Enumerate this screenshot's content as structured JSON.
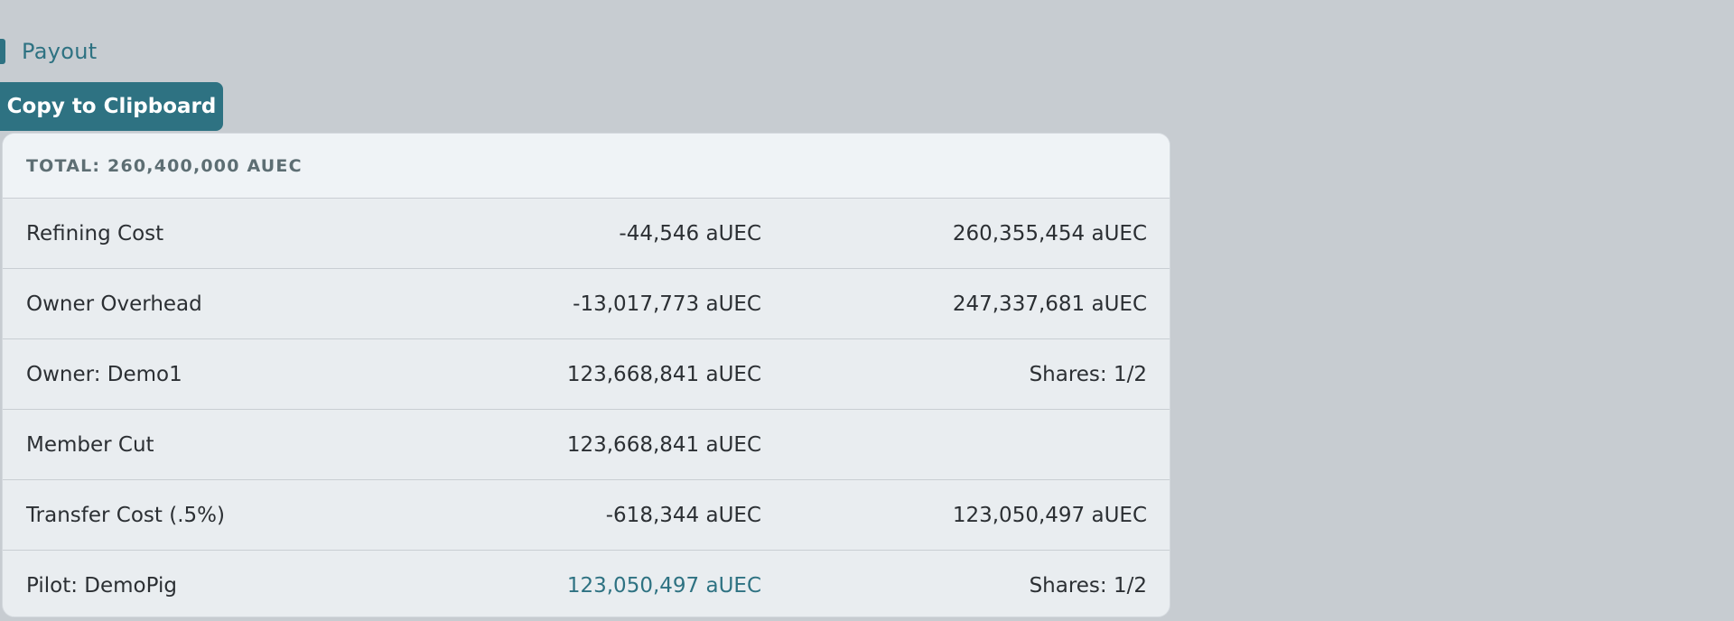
{
  "section": {
    "title": "Payout"
  },
  "toolbar": {
    "copy_label": "Copy to Clipboard"
  },
  "summary": {
    "total": "TOTAL: 260,400,000 AUEC"
  },
  "rows": [
    {
      "label": "Refining Cost",
      "amount": "-44,546 aUEC",
      "extra": "260,355,454 aUEC"
    },
    {
      "label": "Owner Overhead",
      "amount": "-13,017,773 aUEC",
      "extra": "247,337,681 aUEC"
    },
    {
      "label": "Owner: Demo1",
      "amount": "123,668,841 aUEC",
      "extra": "Shares: 1/2"
    },
    {
      "label": "Member Cut",
      "amount": "123,668,841 aUEC",
      "extra": ""
    },
    {
      "label": "Transfer Cost (.5%)",
      "amount": "-618,344 aUEC",
      "extra": "123,050,497 aUEC"
    },
    {
      "label": "Pilot: DemoPig",
      "amount": "123,050,497 aUEC",
      "extra": "Shares: 1/2"
    }
  ],
  "colors": {
    "accent": "#2e7282",
    "background": "#c7ccd1",
    "card": "#e9edf0"
  }
}
